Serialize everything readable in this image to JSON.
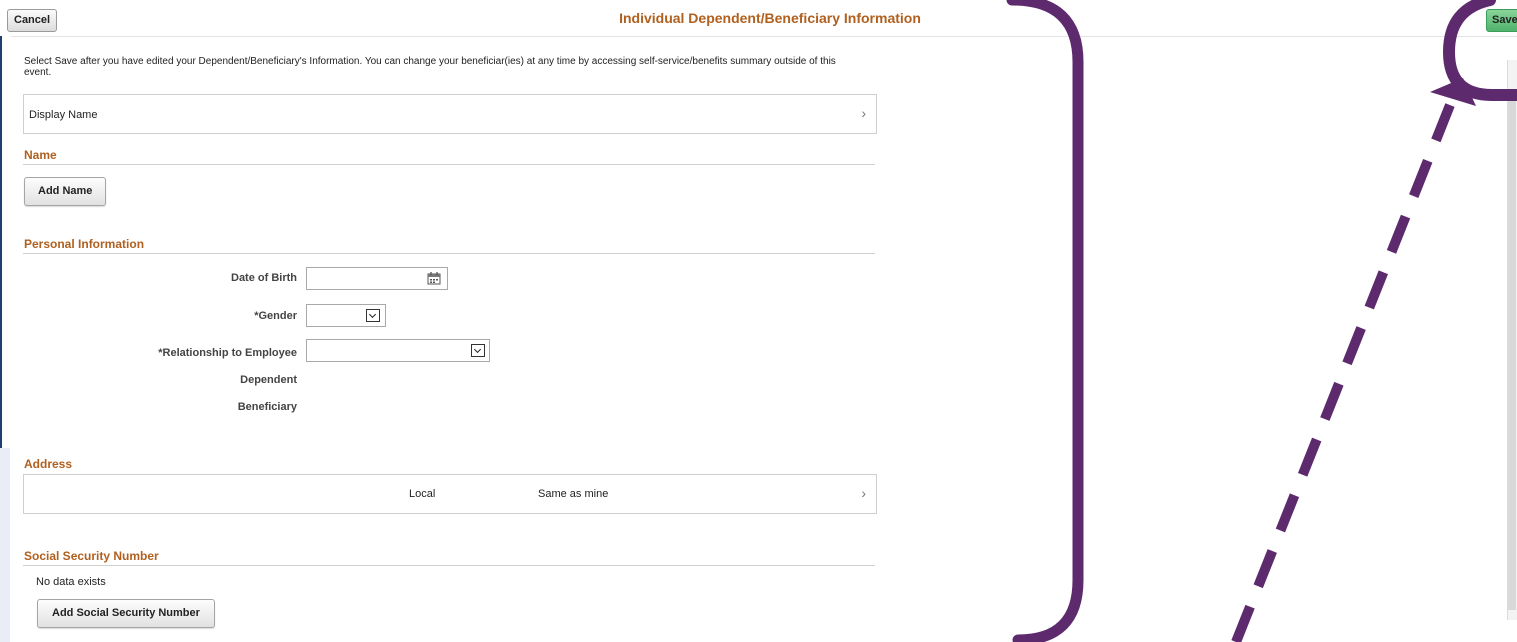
{
  "header": {
    "title": "Individual Dependent/Beneficiary Information",
    "cancel_label": "Cancel",
    "save_label": "Save"
  },
  "instructions": "Select Save after you have edited your Dependent/Beneficiary's Information. You can change your beneficiar(ies) at any time by accessing self-service/benefits summary outside of this event.",
  "display_name_row": {
    "label": "Display Name"
  },
  "name_section": {
    "title": "Name",
    "add_name_label": "Add Name"
  },
  "personal_info": {
    "title": "Personal Information",
    "date_of_birth_label": "Date of Birth",
    "date_of_birth_value": "",
    "gender_label": "*Gender",
    "gender_value": "",
    "relationship_label": "*Relationship to Employee",
    "relationship_value": "",
    "dependent_label": "Dependent",
    "beneficiary_label": "Beneficiary"
  },
  "address": {
    "title": "Address",
    "type": "Local",
    "value": "Same as mine"
  },
  "ssn": {
    "title": "Social Security Number",
    "empty_text": "No data exists",
    "add_label": "Add Social Security Number"
  },
  "icons": {
    "calendar": "calendar-icon",
    "chevron": "chevron-right-icon",
    "dropdown": "chevron-down-icon"
  },
  "colors": {
    "section_title": "#b0601f",
    "annotation": "#5e2a6e",
    "save_button": "#4fb36b"
  }
}
